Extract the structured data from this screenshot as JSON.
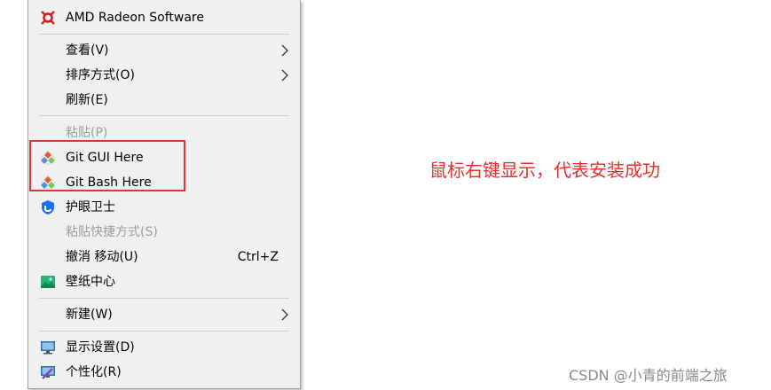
{
  "menu": {
    "items": [
      {
        "label": "AMD Radeon Software",
        "icon": "amd-radeon-icon"
      },
      {
        "label": "查看(V)",
        "submenu": true
      },
      {
        "label": "排序方式(O)",
        "submenu": true
      },
      {
        "label": "刷新(E)"
      },
      {
        "label": "粘贴(P)",
        "disabled": true
      },
      {
        "label": "Git GUI Here",
        "icon": "git-gui-icon"
      },
      {
        "label": "Git Bash Here",
        "icon": "git-bash-icon"
      },
      {
        "label": "护眼卫士",
        "icon": "eye-shield-icon"
      },
      {
        "label": "粘贴快捷方式(S)",
        "disabled": true
      },
      {
        "label": "撤消 移动(U)",
        "shortcut": "Ctrl+Z"
      },
      {
        "label": "壁纸中心",
        "icon": "wallpaper-icon"
      },
      {
        "label": "新建(W)",
        "submenu": true
      },
      {
        "label": "显示设置(D)",
        "icon": "display-settings-icon"
      },
      {
        "label": "个性化(R)",
        "icon": "personalize-icon"
      }
    ]
  },
  "annotation": {
    "caption": "鼠标右键显示，代表安装成功",
    "highlight_color": "#e03434"
  },
  "watermark": "CSDN @小青的前端之旅"
}
